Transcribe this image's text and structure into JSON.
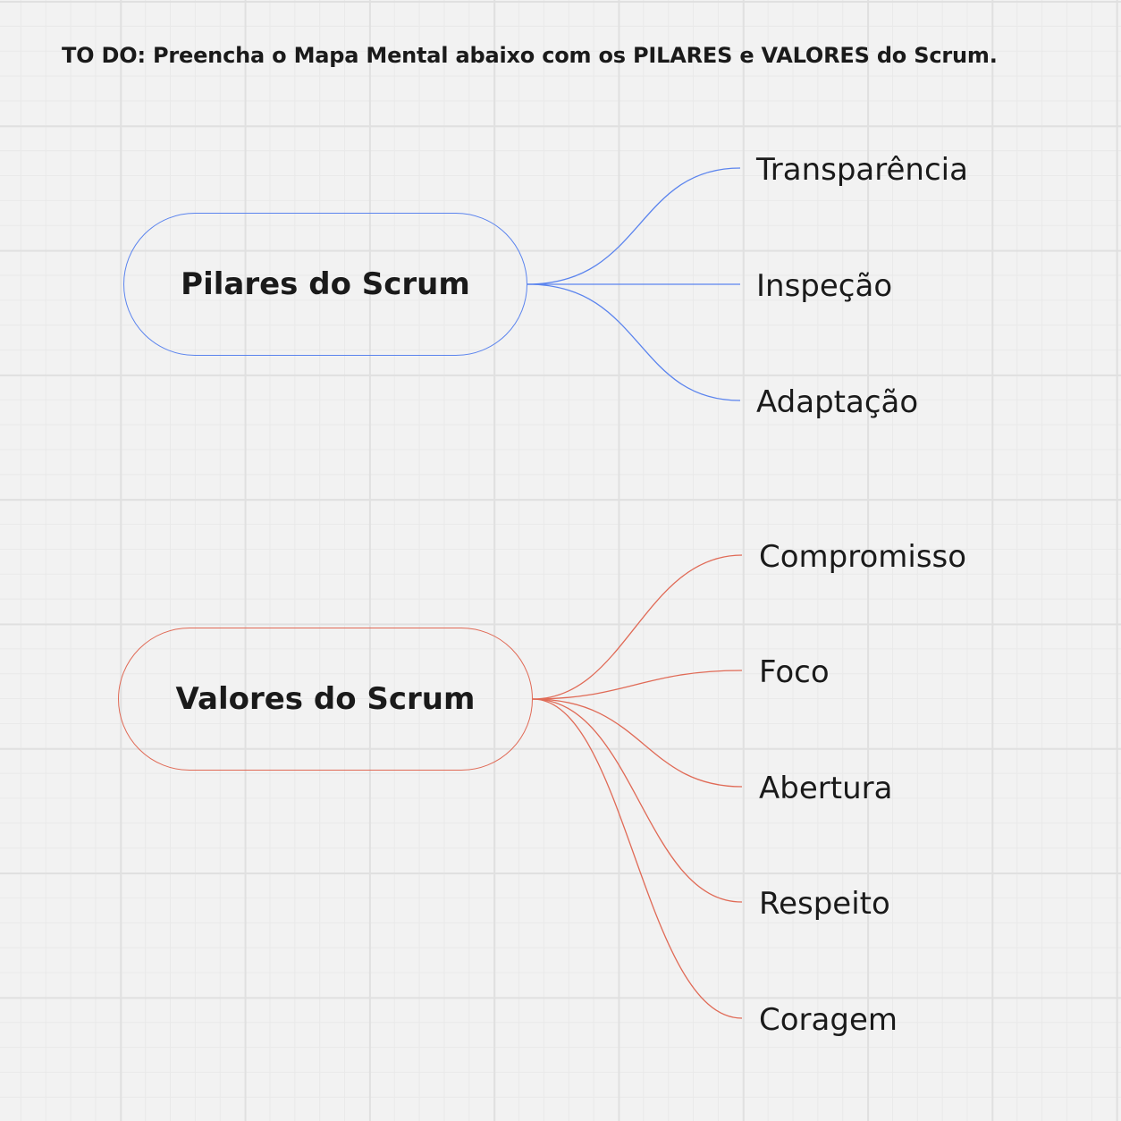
{
  "title": "TO DO: Preencha o Mapa Mental abaixo com os PILARES e VALORES do Scrum.",
  "colors": {
    "pilares_accent": "#5b84ee",
    "valores_accent": "#e06a56",
    "background": "#f2f2f2",
    "grid": "#e0e0e0"
  },
  "pilares": {
    "label": "Pilares do Scrum",
    "children": [
      "Transparência",
      "Inspeção",
      "Adaptação"
    ]
  },
  "valores": {
    "label": "Valores do Scrum",
    "children": [
      "Compromisso",
      "Foco",
      "Abertura",
      "Respeito",
      "Coragem"
    ]
  }
}
